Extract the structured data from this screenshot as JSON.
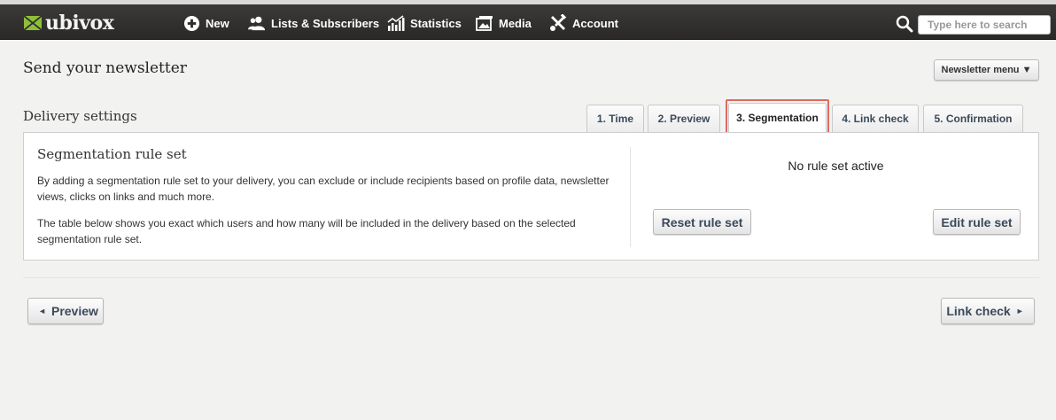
{
  "brand": {
    "name": "ubivox",
    "accent": "#8fbf3a"
  },
  "nav": {
    "new": "New",
    "lists": "Lists & Subscribers",
    "statistics": "Statistics",
    "media": "Media",
    "account": "Account"
  },
  "search": {
    "placeholder": "Type here to search"
  },
  "page": {
    "title": "Send your newsletter",
    "newsletter_menu": "Newsletter menu ▼"
  },
  "delivery": {
    "label": "Delivery settings",
    "tabs": [
      "1. Time",
      "2. Preview",
      "3. Segmentation",
      "4. Link check",
      "5. Confirmation"
    ],
    "active_tab": "3. Segmentation",
    "highlight_color": "#e06a5f"
  },
  "segmentation": {
    "title": "Segmentation rule set",
    "text1": "By adding a segmentation rule set to your delivery, you can exclude or include recipients based on profile data, newsletter views, clicks on links and much more.",
    "text2": "The table below shows you exact which users and how many will be included in the delivery based on the selected segmentation rule set.",
    "status": "No rule set active",
    "reset_label": "Reset rule set",
    "edit_label": "Edit rule set"
  },
  "footer_nav": {
    "prev_label": "Preview",
    "next_label": "Link check"
  }
}
